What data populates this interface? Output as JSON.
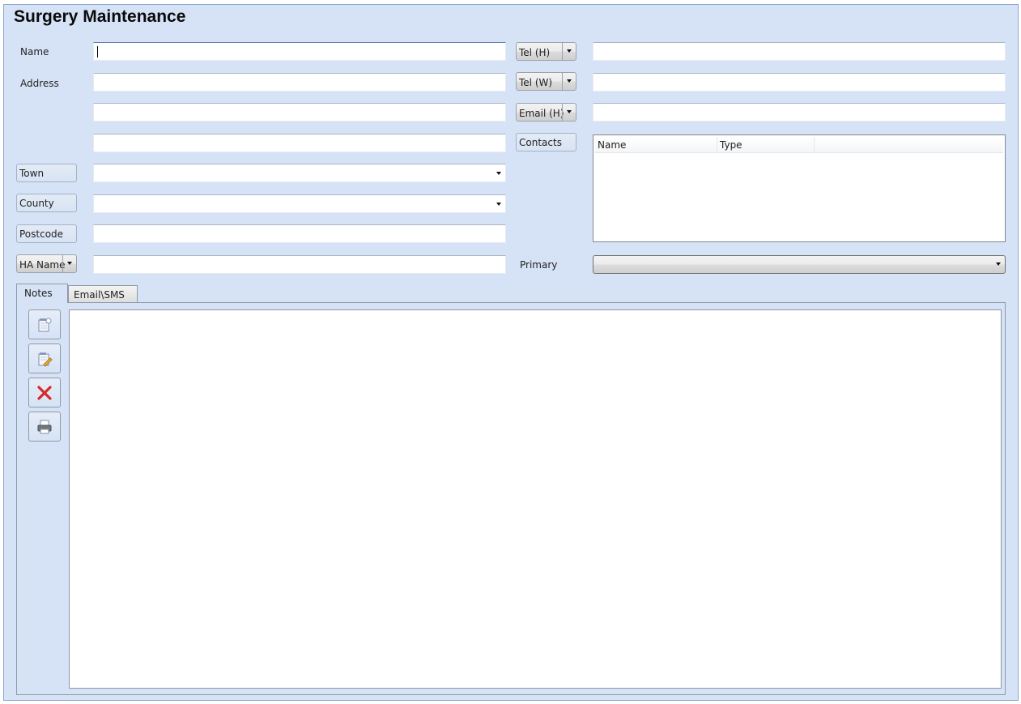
{
  "page": {
    "title": "Surgery Maintenance"
  },
  "form": {
    "name": {
      "label": "Name",
      "value": ""
    },
    "address": {
      "label": "Address",
      "line1": "",
      "line2": "",
      "line3": ""
    },
    "town": {
      "label": "Town",
      "value": ""
    },
    "county": {
      "label": "County",
      "value": ""
    },
    "postcode": {
      "label": "Postcode",
      "value": ""
    },
    "ha_name": {
      "label": "HA Name",
      "value": ""
    }
  },
  "contact_fields": [
    {
      "label": "Tel (H)",
      "value": ""
    },
    {
      "label": "Tel (W)",
      "value": ""
    },
    {
      "label": "Email (H)",
      "value": ""
    }
  ],
  "contacts": {
    "label": "Contacts",
    "columns": [
      "Name",
      "Type"
    ],
    "rows": []
  },
  "primary": {
    "label": "Primary",
    "value": ""
  },
  "tabs": [
    {
      "label": "Notes",
      "active": true
    },
    {
      "label": "Email\\SMS",
      "active": false
    }
  ],
  "notes": {
    "value": "",
    "toolbar": [
      {
        "icon": "new-note-icon"
      },
      {
        "icon": "edit-note-icon"
      },
      {
        "icon": "delete-icon"
      },
      {
        "icon": "print-icon"
      }
    ]
  },
  "colors": {
    "background": "#d6e3f7",
    "border": "#8aa6d0",
    "delete": "#d42a2a"
  }
}
